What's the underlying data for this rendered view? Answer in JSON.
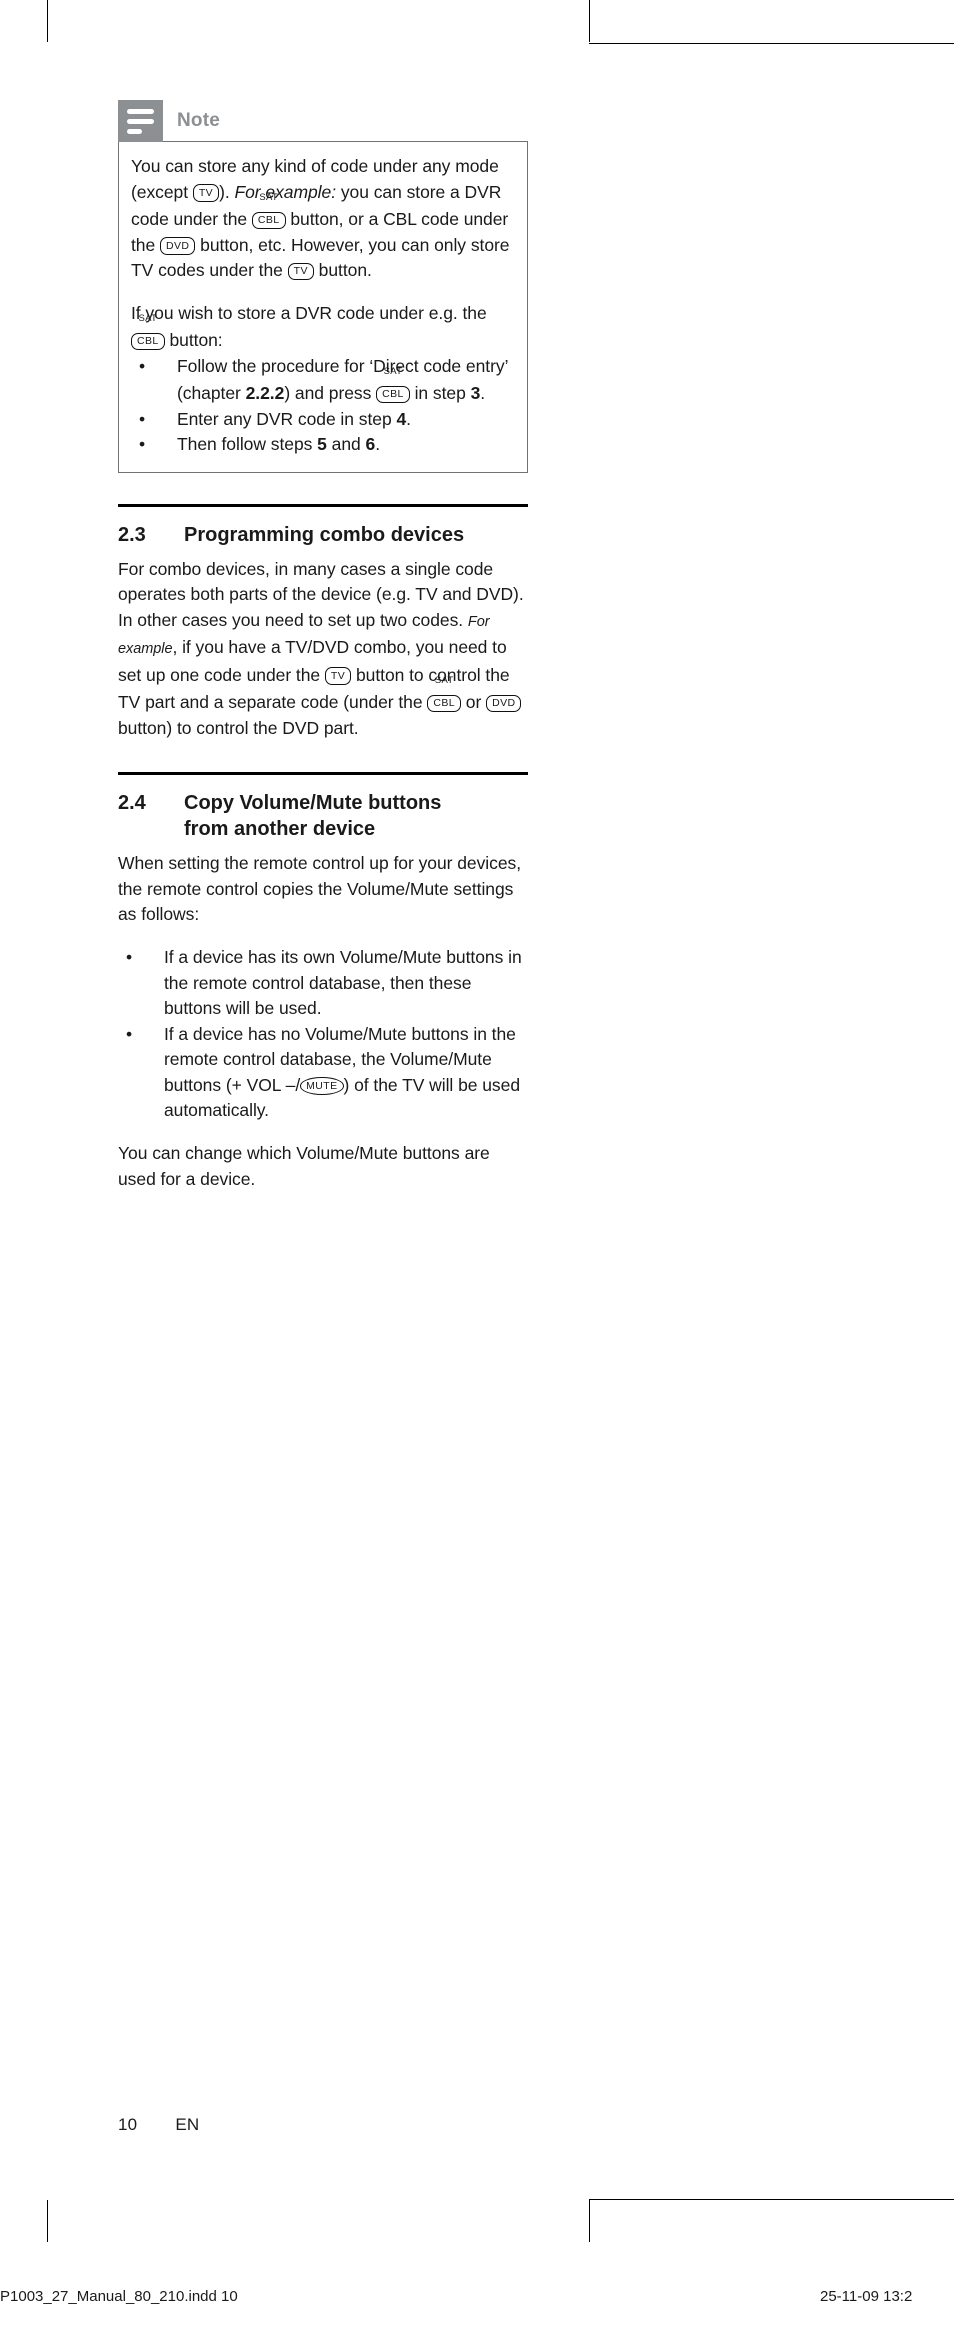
{
  "note": {
    "icon_name": "note-lines-icon",
    "title": "Note",
    "header_bg": "#8c9093",
    "para1": {
      "seg1": "You can store any kind of code under any mode (except ",
      "btn1": "TV",
      "seg2": "). ",
      "em1": "For example:",
      "seg3": " you can store a DVR code under the ",
      "btn2_sup": "SAT",
      "btn2": "CBL",
      "seg4": " button, or a CBL code under the ",
      "btn3": "DVD",
      "seg5": " button, etc. However, you can only store TV codes under the ",
      "btn4": "TV",
      "seg6": " button."
    },
    "para2": {
      "seg1": "If you wish to store a DVR code under e.g. the ",
      "btn1_sup": "SAT",
      "btn1": "CBL",
      "seg2": " button:"
    },
    "bullets": [
      {
        "seg1": "Follow the procedure for ‘Direct code entry’ (chapter ",
        "bold1": "2.2.2",
        "seg2": ") and press ",
        "btn_sup": "SAT",
        "btn": "CBL",
        "seg3": " in step ",
        "bold2": "3",
        "seg4": "."
      },
      {
        "seg1": "Enter any DVR code in step ",
        "bold1": "4",
        "seg2": "."
      },
      {
        "seg1": "Then follow steps ",
        "bold1": "5",
        "seg2": " and ",
        "bold2": "6",
        "seg3": "."
      }
    ]
  },
  "section_23": {
    "number": "2.3",
    "title": "Programming combo devices",
    "body": {
      "seg1": "For combo devices, in many cases a single code operates both parts of the device (e.g. TV and DVD). In other cases you need to set up two codes. ",
      "em1": "For example",
      "seg2": ", if you have a TV/DVD combo, you need to set up one code under the ",
      "btn1": "TV",
      "seg3": " button to control the TV part and a separate code (under the ",
      "btn2_sup": "SAT",
      "btn2": "CBL",
      "seg4": " or ",
      "btn3": "DVD",
      "seg5": " button) to control the DVD part."
    }
  },
  "section_24": {
    "number": "2.4",
    "title_line1": "Copy Volume/Mute buttons",
    "title_line2": "from another device",
    "intro": "When setting the remote control up for your devices, the remote control copies the Volume/Mute settings as follows:",
    "bullets": [
      {
        "text": "If a device has its own Volume/Mute buttons in the remote control database, then these buttons will be used."
      },
      {
        "seg1": "If a device has no Volume/Mute buttons in the remote control database, the Volume/Mute buttons (+ VOL –/",
        "btn": "MUTE",
        "seg2": ") of the TV will be used automatically."
      }
    ],
    "outro": "You can change which Volume/Mute buttons are used for a device."
  },
  "footer": {
    "page_number": "10",
    "language": "EN"
  },
  "print_strip": {
    "left": "P1003_27_Manual_80_210.indd   10",
    "right": "25-11-09   13:2"
  }
}
